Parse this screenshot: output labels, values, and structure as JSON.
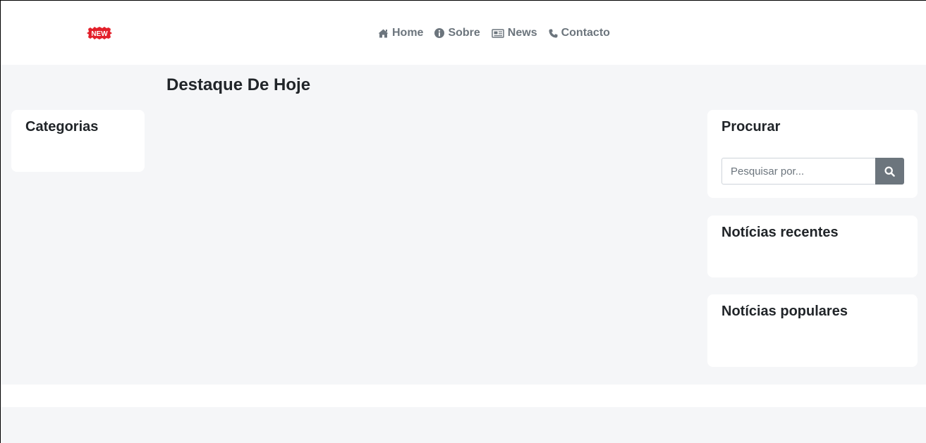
{
  "header": {
    "logo": {
      "text": "NEW",
      "color": "#e3202a",
      "icon": "new-badge-icon"
    },
    "nav": [
      {
        "label": "Home",
        "icon": "home-icon"
      },
      {
        "label": "Sobre",
        "icon": "info-icon"
      },
      {
        "label": "News",
        "icon": "newspaper-icon"
      },
      {
        "label": "Contacto",
        "icon": "phone-icon"
      }
    ]
  },
  "main": {
    "title": "Destaque De Hoje"
  },
  "sidebar_left": {
    "categories_title": "Categorias"
  },
  "sidebar_right": {
    "search_title": "Procurar",
    "search_placeholder": "Pesquisar por...",
    "search_button_icon": "search-icon",
    "recent_title": "Notícias recentes",
    "popular_title": "Notícias populares"
  },
  "colors": {
    "background": "#f5f6f8",
    "card": "#ffffff",
    "nav_text": "#6c757d",
    "button": "#6c757d",
    "heading": "#212529"
  }
}
